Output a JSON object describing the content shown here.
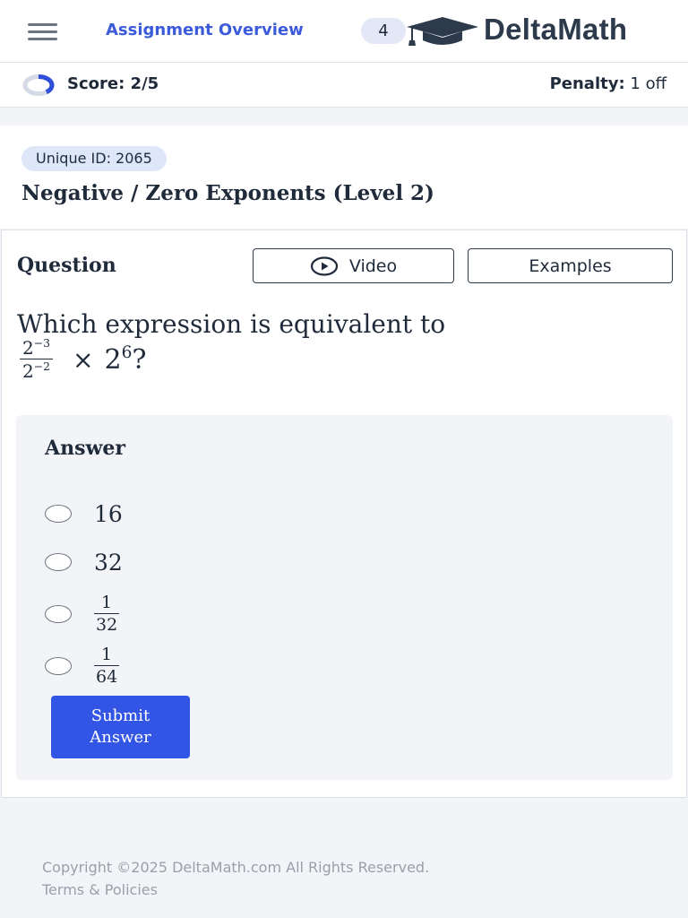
{
  "topbar": {
    "menu_icon": "hamburger-menu-icon",
    "assignment_link": "Assignment Overview",
    "assignment_count": "4",
    "logo_icon": "graduation-cap-icon",
    "logo_text": "DeltaMath"
  },
  "scorebar": {
    "score_icon": "progress-ring-icon",
    "score_label": "Score: 2/5",
    "score_fraction": 0.4,
    "penalty_label": "Penalty:",
    "penalty_value": "1 off"
  },
  "problem": {
    "unique_id": "Unique ID: 2065",
    "skill_title": "Negative / Zero Exponents (Level 2)"
  },
  "question": {
    "heading": "Question",
    "video_label": "Video",
    "video_icon": "play-circle-icon",
    "examples_label": "Examples",
    "prompt": "Which expression is equivalent to",
    "expression": {
      "num_base": "2",
      "num_exp": "−3",
      "den_base": "2",
      "den_exp": "−2",
      "operator": "×",
      "factor_base": "2",
      "factor_exp": "6",
      "end": "?"
    }
  },
  "answer": {
    "heading": "Answer",
    "choices": [
      {
        "text": "16"
      },
      {
        "text": "32"
      },
      {
        "num": "1",
        "den": "32"
      },
      {
        "num": "1",
        "den": "64"
      }
    ],
    "submit_label": "Submit Answer"
  },
  "footer": {
    "copyright": "Copyright ©2025 DeltaMath.com All Rights Reserved.",
    "terms": "Terms & Policies"
  },
  "colors": {
    "accent_blue": "#3355e6",
    "link_blue": "#3b5bdb",
    "text_dark": "#1f2a3a",
    "background": "#f3f4f7"
  }
}
